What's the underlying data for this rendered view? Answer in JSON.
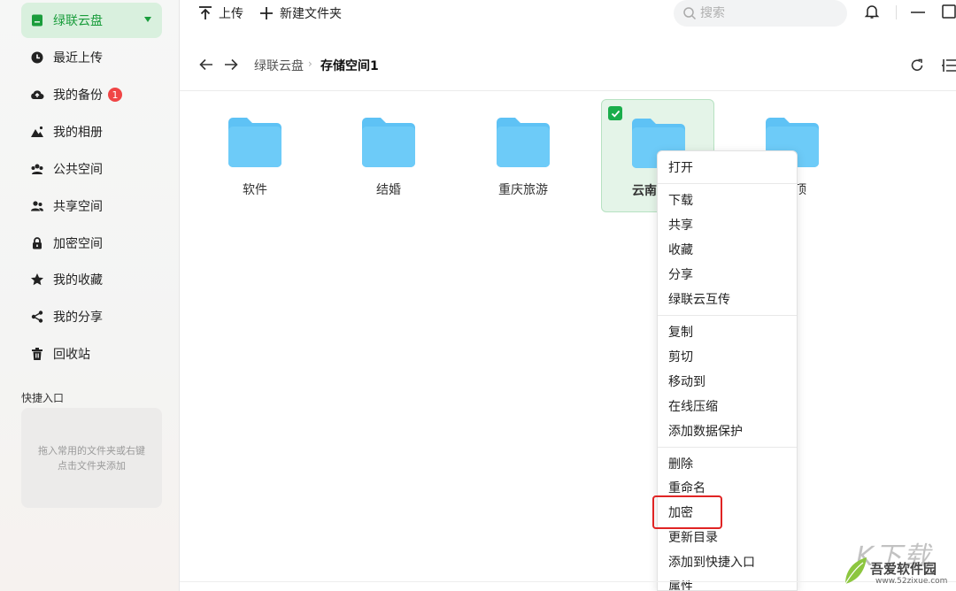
{
  "sidebar": {
    "items": [
      {
        "label": "绿联云盘",
        "icon": "drive-icon",
        "active": true
      },
      {
        "label": "最近上传",
        "icon": "clock-icon"
      },
      {
        "label": "我的备份",
        "icon": "cloud-upload-icon",
        "badge": "1"
      },
      {
        "label": "我的相册",
        "icon": "photo-icon"
      },
      {
        "label": "公共空间",
        "icon": "group-icon"
      },
      {
        "label": "共享空间",
        "icon": "people-icon"
      },
      {
        "label": "加密空间",
        "icon": "lock-icon"
      },
      {
        "label": "我的收藏",
        "icon": "star-icon"
      },
      {
        "label": "我的分享",
        "icon": "share-icon"
      },
      {
        "label": "回收站",
        "icon": "trash-icon"
      }
    ],
    "quick_access": {
      "title": "快捷入口",
      "hint": "拖入常用的文件夹或右键点击文件夹添加"
    }
  },
  "toolbar": {
    "upload_label": "上传",
    "new_folder_label": "新建文件夹",
    "search_placeholder": "搜索"
  },
  "breadcrumb": {
    "parent": "绿联云盘",
    "current": "存储空间1"
  },
  "files": [
    {
      "name": "软件",
      "selected": false
    },
    {
      "name": "结婚",
      "selected": false
    },
    {
      "name": "重庆旅游",
      "selected": false
    },
    {
      "name": "云南",
      "selected": true
    },
    {
      "name": "顶",
      "selected": false
    }
  ],
  "context_menu": {
    "groups": [
      [
        "打开"
      ],
      [
        "下载",
        "共享",
        "收藏",
        "分享",
        "绿联云互传"
      ],
      [
        "复制",
        "剪切",
        "移动到",
        "在线压缩",
        "添加数据保护"
      ],
      [
        "删除",
        "重命名",
        "加密",
        "更新目录",
        "添加到快捷入口",
        "属性"
      ]
    ],
    "highlighted": "加密"
  },
  "watermark": {
    "big": "K下载",
    "line1": "吾爱软件园",
    "line2": "www.52zixue.com"
  },
  "colors": {
    "accent": "#1a9d3c",
    "active_bg": "#d9f0de",
    "folder": "#5ec2f5",
    "badge": "#f04545",
    "highlight_border": "#e02424"
  }
}
